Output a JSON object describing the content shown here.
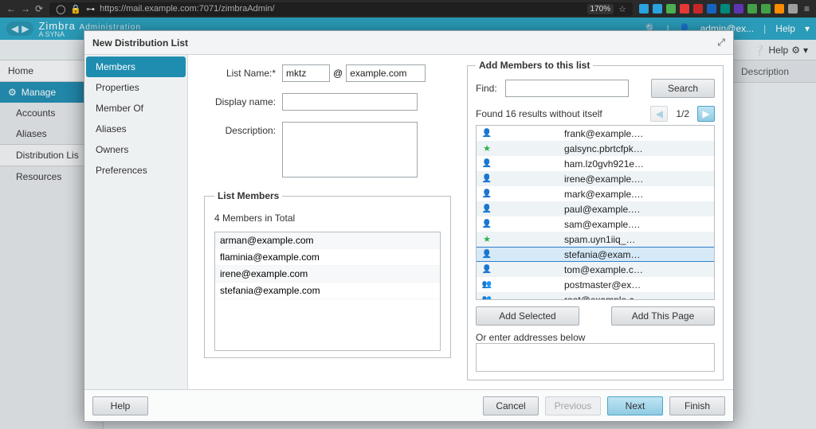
{
  "browser": {
    "url": "https://mail.example.com:7071/zimbraAdmin/",
    "zoom": "170%"
  },
  "ext_colors": [
    "#2aa3e0",
    "#2aa3e0",
    "#4caf50",
    "#e53935",
    "#c62828",
    "#1565c0",
    "#00897b",
    "#5e35b1",
    "#43a047",
    "#43a047",
    "#fb8c00",
    "#9e9e9e"
  ],
  "app": {
    "brand": "Zimbra",
    "brand_sub": "Administration",
    "tagline": "A SYNA",
    "admin_label": "admin@ex...",
    "help_label": "Help"
  },
  "sidebar": {
    "home": "Home",
    "manage": "Manage",
    "items": [
      "Accounts",
      "Aliases",
      "Distribution Lis",
      "Resources"
    ],
    "help2": "Help",
    "desc_col": "Description"
  },
  "dialog": {
    "title": "New Distribution List",
    "nav": [
      "Members",
      "Properties",
      "Member Of",
      "Aliases",
      "Owners",
      "Preferences"
    ],
    "nav_active": 0,
    "form": {
      "list_name_label": "List Name:*",
      "list_name_value": "mktz",
      "at": "@",
      "domain_value": "example.com",
      "display_label": "Display name:",
      "display_value": "",
      "desc_label": "Description:",
      "desc_value": ""
    },
    "members_panel": {
      "legend": "List Members",
      "total": "4 Members in Total",
      "items": [
        "arman@example.com",
        "flaminia@example.com",
        "irene@example.com",
        "stefania@example.com"
      ]
    },
    "add_panel": {
      "legend": "Add Members to this list",
      "find_label": "Find:",
      "find_value": "",
      "search_btn": "Search",
      "results_txt": "Found 16 results without itself",
      "page": "1/2",
      "results": [
        {
          "icon": "user",
          "email": "frank@example.…",
          "selected": false
        },
        {
          "icon": "star",
          "email": "galsync.pbrtcfpk…",
          "selected": false
        },
        {
          "icon": "user",
          "email": "ham.lz0gvh921e…",
          "selected": false
        },
        {
          "icon": "user",
          "email": "irene@example.…",
          "selected": false
        },
        {
          "icon": "user",
          "email": "mark@example.…",
          "selected": false
        },
        {
          "icon": "user",
          "email": "paul@example.…",
          "selected": false
        },
        {
          "icon": "user",
          "email": "sam@example.…",
          "selected": false
        },
        {
          "icon": "star",
          "email": "spam.uyn1iiq_…",
          "selected": false
        },
        {
          "icon": "user",
          "email": "stefania@exam…",
          "selected": true
        },
        {
          "icon": "user",
          "email": "tom@example.c…",
          "selected": false
        },
        {
          "icon": "group",
          "email": "postmaster@ex…",
          "selected": false
        },
        {
          "icon": "group",
          "email": "root@example.c…",
          "selected": false
        }
      ],
      "add_selected": "Add Selected",
      "add_page": "Add This Page",
      "enter_label": "Or enter addresses below"
    },
    "footer": {
      "help": "Help",
      "cancel": "Cancel",
      "previous": "Previous",
      "next": "Next",
      "finish": "Finish"
    }
  }
}
